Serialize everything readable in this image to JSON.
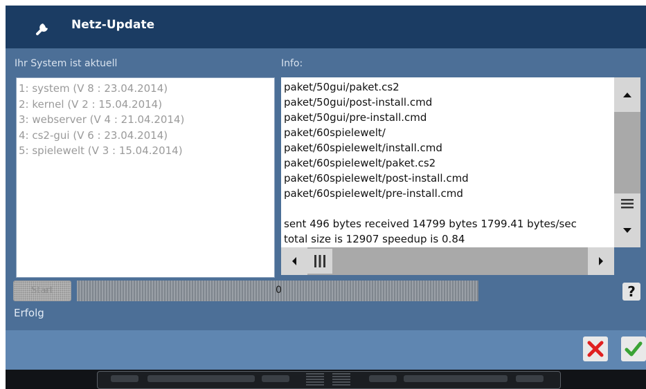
{
  "dialog": {
    "title": "Netz-Update",
    "title_icon": "wrench-icon",
    "left_label": "Ihr System ist aktuell",
    "info_label": "Info:",
    "packages": [
      "1: system (V 8 : 23.04.2014)",
      "2: kernel (V 2 : 15.04.2014)",
      "3: webserver (V 4 : 21.04.2014)",
      "4: cs2-gui (V 6 : 23.04.2014)",
      "5: spielewelt (V 3 : 15.04.2014)"
    ],
    "info_lines": [
      "paket/50gui/paket.cs2",
      "paket/50gui/post-install.cmd",
      "paket/50gui/pre-install.cmd",
      "paket/60spielewelt/",
      "paket/60spielewelt/install.cmd",
      "paket/60spielewelt/paket.cs2",
      "paket/60spielewelt/post-install.cmd",
      "paket/60spielewelt/pre-install.cmd",
      "",
      "sent 496 bytes  received 14799 bytes  1799.41 bytes/sec",
      "total size is 12907  speedup is 0.84"
    ],
    "start_label": "Start",
    "progress_value": "0",
    "help_label": "?",
    "status": "Erfolg"
  },
  "colors": {
    "title_bar": "#1b3c63",
    "panel": "#4c6f97",
    "footer": "#5f86b1",
    "cancel_red": "#e02020",
    "ok_green": "#3aa335"
  }
}
